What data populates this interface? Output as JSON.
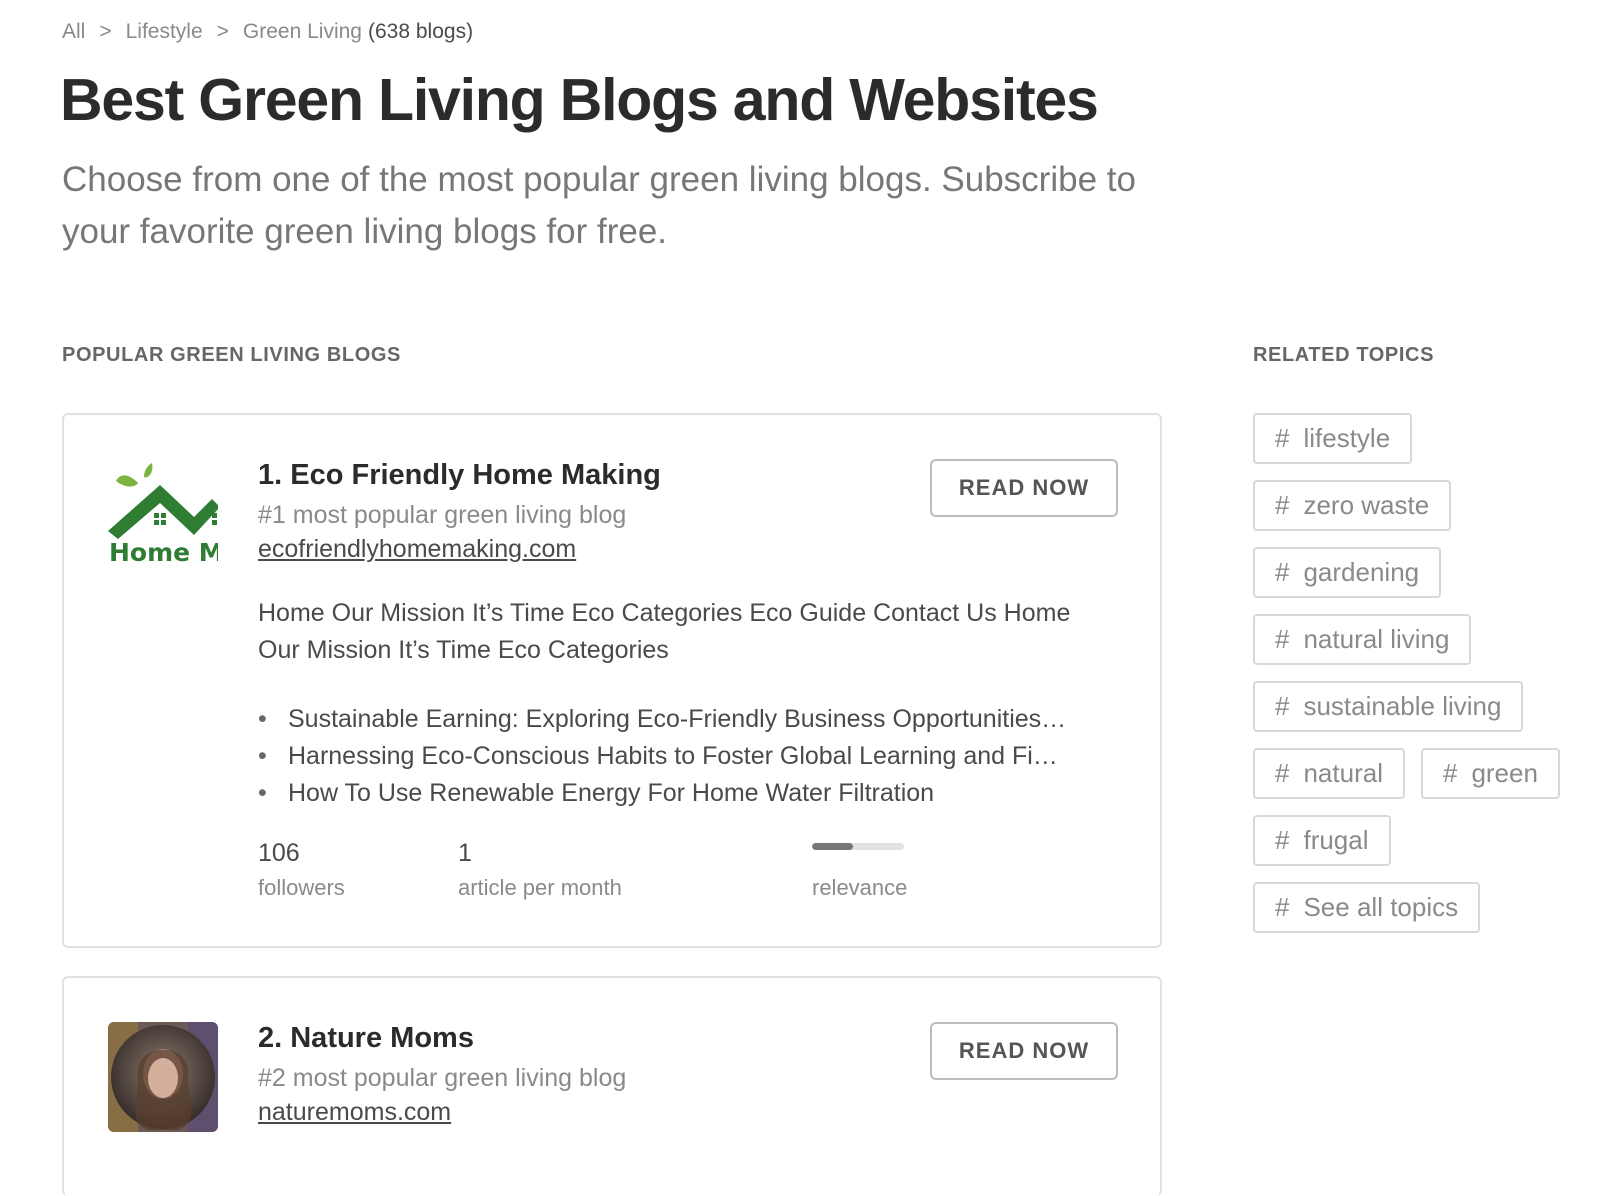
{
  "breadcrumb": {
    "items": [
      "All",
      "Lifestyle",
      "Green Living"
    ],
    "separator": ">",
    "count": "(638 blogs)"
  },
  "page": {
    "title": "Best Green Living Blogs and Websites",
    "subtitle": "Choose from one of the most popular green living blogs. Subscribe to your favorite green living blogs for free."
  },
  "popular": {
    "heading": "POPULAR GREEN LIVING BLOGS",
    "blogs": [
      {
        "title": "1. Eco Friendly Home Making",
        "rank": "#1 most popular green living blog",
        "url": "ecofriendlyhomemaking.com",
        "read_label": "READ NOW",
        "logo_text": "Home M",
        "description": "Home Our Mission It’s Time Eco Categories Eco Guide Contact Us Home Our Mission It’s Time Eco Categories",
        "posts": [
          "Sustainable Earning: Exploring Eco-Friendly Business Opportunities…",
          "Harnessing Eco-Conscious Habits to Foster Global Learning and Fi…",
          "How To Use Renewable Energy For Home Water Filtration"
        ],
        "followers_value": "106",
        "followers_label": "followers",
        "frequency_value": "1",
        "frequency_label": "article per month",
        "relevance_label": "relevance",
        "relevance_fraction": 0.45
      },
      {
        "title": "2. Nature Moms",
        "rank": "#2 most popular green living blog",
        "url": "naturemoms.com",
        "read_label": "READ NOW"
      }
    ]
  },
  "related": {
    "heading": "RELATED TOPICS",
    "hash_symbol": "#",
    "topics": [
      "lifestyle",
      "zero waste",
      "gardening",
      "natural living",
      "sustainable living",
      "natural",
      "green",
      "frugal",
      "See all topics"
    ]
  },
  "colors": {
    "logo_green": "#2e7d32",
    "leaf_green": "#7cb342",
    "relevance_fill": "#777777"
  }
}
